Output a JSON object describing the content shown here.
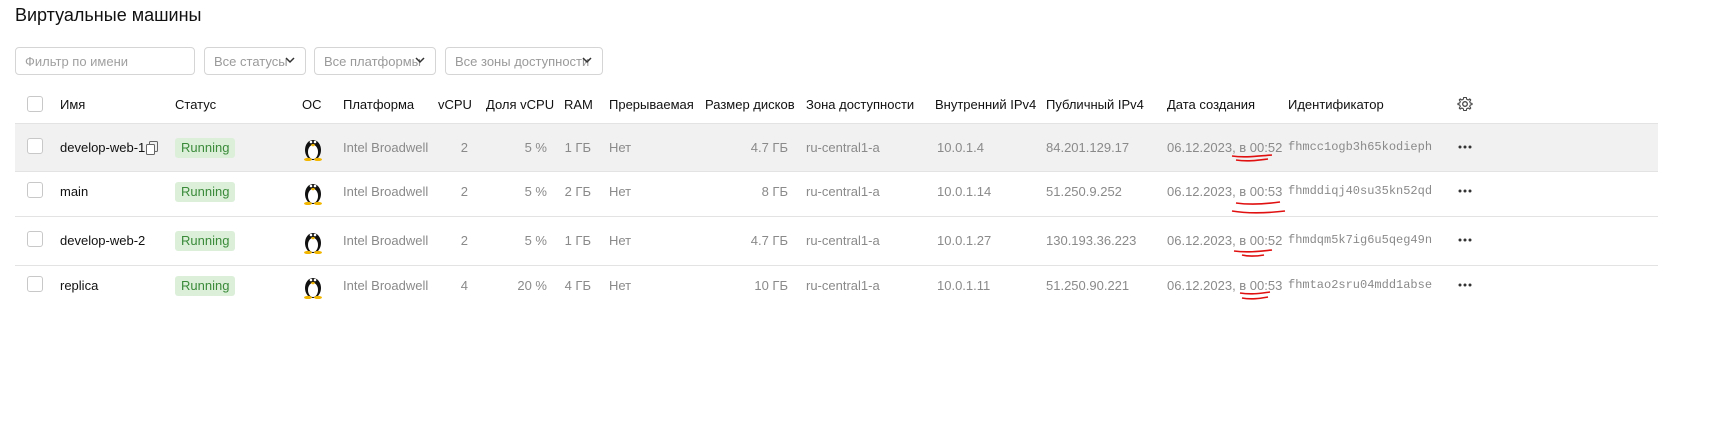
{
  "page": {
    "title": "Виртуальные машины"
  },
  "filters": {
    "name_placeholder": "Фильтр по имени",
    "status": "Все статусы",
    "platform": "Все платформы",
    "zone": "Все зоны доступности"
  },
  "table": {
    "headers": {
      "name": "Имя",
      "status": "Статус",
      "os": "ОС",
      "platform": "Платформа",
      "vcpu": "vCPU",
      "vcpu_share": "Доля vCPU",
      "ram": "RAM",
      "preemptible": "Прерываемая",
      "disk_size": "Размер дисков",
      "zone": "Зона доступности",
      "internal_ip": "Внутренний IPv4",
      "public_ip": "Публичный IPv4",
      "created": "Дата создания",
      "id": "Идентификатор"
    },
    "rows": [
      {
        "name": "develop-web-1",
        "status": "Running",
        "os_icon": "linux-tux-icon",
        "platform": "Intel Broadwell",
        "vcpu": "2",
        "vcpu_share": "5 %",
        "ram": "1 ГБ",
        "preemptible": "Нет",
        "disk_size": "4.7 ГБ",
        "zone": "ru-central1-a",
        "internal_ip": "10.0.1.4",
        "public_ip": "84.201.129.17",
        "created": "06.12.2023, в 00:52",
        "id": "fhmcc1ogb3h65kodieph"
      },
      {
        "name": "main",
        "status": "Running",
        "os_icon": "linux-tux-icon",
        "platform": "Intel Broadwell",
        "vcpu": "2",
        "vcpu_share": "5 %",
        "ram": "2 ГБ",
        "preemptible": "Нет",
        "disk_size": "8 ГБ",
        "zone": "ru-central1-a",
        "internal_ip": "10.0.1.14",
        "public_ip": "51.250.9.252",
        "created": "06.12.2023, в 00:53",
        "id": "fhmddiqj40su35kn52qd"
      },
      {
        "name": "develop-web-2",
        "status": "Running",
        "os_icon": "linux-tux-icon",
        "platform": "Intel Broadwell",
        "vcpu": "2",
        "vcpu_share": "5 %",
        "ram": "1 ГБ",
        "preemptible": "Нет",
        "disk_size": "4.7 ГБ",
        "zone": "ru-central1-a",
        "internal_ip": "10.0.1.27",
        "public_ip": "130.193.36.223",
        "created": "06.12.2023, в 00:52",
        "id": "fhmdqm5k7ig6u5qeg49n"
      },
      {
        "name": "replica",
        "status": "Running",
        "os_icon": "linux-tux-icon",
        "platform": "Intel Broadwell",
        "vcpu": "4",
        "vcpu_share": "20 %",
        "ram": "4 ГБ",
        "preemptible": "Нет",
        "disk_size": "10 ГБ",
        "zone": "ru-central1-a",
        "internal_ip": "10.0.1.11",
        "public_ip": "51.250.90.221",
        "created": "06.12.2023, в 00:53",
        "id": "fhmtao2sru04mdd1abse"
      }
    ]
  },
  "colors": {
    "running_bg": "#dcf0d9",
    "running_text": "#3a8a3a",
    "annotation_red": "#e01010",
    "hover_row": "#f1f1f1"
  }
}
